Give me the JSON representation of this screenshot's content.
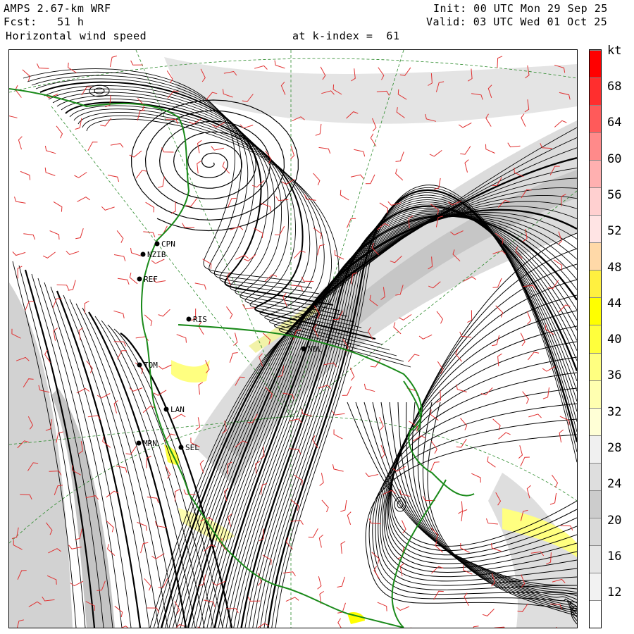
{
  "header": {
    "model": "AMPS 2.67-km WRF",
    "forecast": "Fcst:   51 h",
    "field": "Horizontal wind speed",
    "level": "at k-index =  61",
    "init": "Init: 00 UTC Mon 29 Sep 25",
    "valid": "Valid: 03 UTC Wed 01 Oct 25"
  },
  "colorbar": {
    "unit": "kt",
    "labels": [
      "68",
      "64",
      "60",
      "56",
      "52",
      "48",
      "44",
      "40",
      "36",
      "32",
      "28",
      "24",
      "20",
      "16",
      "12"
    ],
    "colors": [
      "#ff0000",
      "#ff2e2e",
      "#ff5a5a",
      "#ff8a8a",
      "#ffb0b0",
      "#ffd0d0",
      "#ffe4e4",
      "#ffd9a8",
      "#fff040",
      "#ffff00",
      "#ffff3c",
      "#ffff80",
      "#ffffb0",
      "#ffffd6",
      "#f0f0f0",
      "#dedede",
      "#cccccc",
      "#d9d9d9",
      "#e6e6e6",
      "#f2f2f2",
      "#ffffff"
    ]
  },
  "stations": [
    {
      "code": "CPN"
    },
    {
      "code": "NZIB"
    },
    {
      "code": "REF"
    },
    {
      "code": "RIS"
    },
    {
      "code": "NOL"
    },
    {
      "code": "TOM"
    },
    {
      "code": "LAN"
    },
    {
      "code": "SEL"
    },
    {
      "code": "MRN"
    }
  ],
  "colors": {
    "coast": "#1a8a1a",
    "barbs": "#e03030",
    "streamlines": "#000000",
    "grid": "#2a8a2a"
  }
}
